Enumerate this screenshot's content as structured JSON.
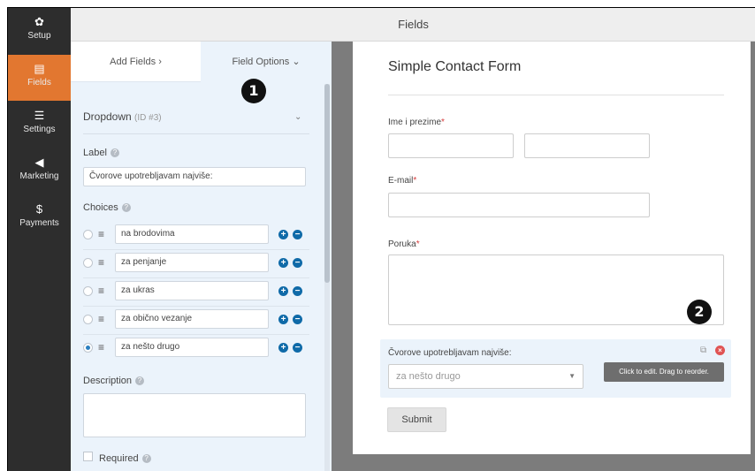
{
  "nav": {
    "items": [
      {
        "label": "Setup",
        "icon": "gear-icon",
        "glyph": "✿"
      },
      {
        "label": "Fields",
        "icon": "fields-icon",
        "glyph": "▤"
      },
      {
        "label": "Settings",
        "icon": "sliders-icon",
        "glyph": "☰"
      },
      {
        "label": "Marketing",
        "icon": "megaphone-icon",
        "glyph": "◀"
      },
      {
        "label": "Payments",
        "icon": "dollar-icon",
        "glyph": "$"
      }
    ],
    "active": "Fields",
    "active_color": "#e27730"
  },
  "header": {
    "title": "Fields"
  },
  "panel": {
    "tabs": {
      "add": "Add Fields",
      "add_chevron": "›",
      "options": "Field Options",
      "options_chevron": "⌄"
    },
    "field": {
      "name": "Dropdown",
      "id": "(ID #3)",
      "chevron": "⌄"
    },
    "label_title": "Label",
    "label_value": "Čvorove upotrebljavam najviše:",
    "choices_title": "Choices",
    "choices": [
      {
        "label": "na brodovima",
        "checked": false
      },
      {
        "label": "za penjanje",
        "checked": false
      },
      {
        "label": "za ukras",
        "checked": false
      },
      {
        "label": "za obično vezanje",
        "checked": false
      },
      {
        "label": "za nešto drugo",
        "checked": true
      }
    ],
    "description_title": "Description",
    "description_value": "",
    "required_label": "Required",
    "help_glyph": "?"
  },
  "form": {
    "title": "Simple Contact Form",
    "name_label": "Ime i prezime",
    "email_label": "E-mail",
    "message_label": "Poruka",
    "required_mark": "*",
    "dropdown_label": "Čvorove upotrebljavam najviše:",
    "dropdown_value": "za nešto drugo",
    "tooltip": "Click to edit. Drag to reorder.",
    "submit": "Submit"
  },
  "markers": {
    "one": "1",
    "two": "2"
  },
  "colors": {
    "accent": "#e27730",
    "link_blue": "#0f6aa8",
    "delete_red": "#e05353",
    "panel_bg": "#ebf3fb"
  }
}
